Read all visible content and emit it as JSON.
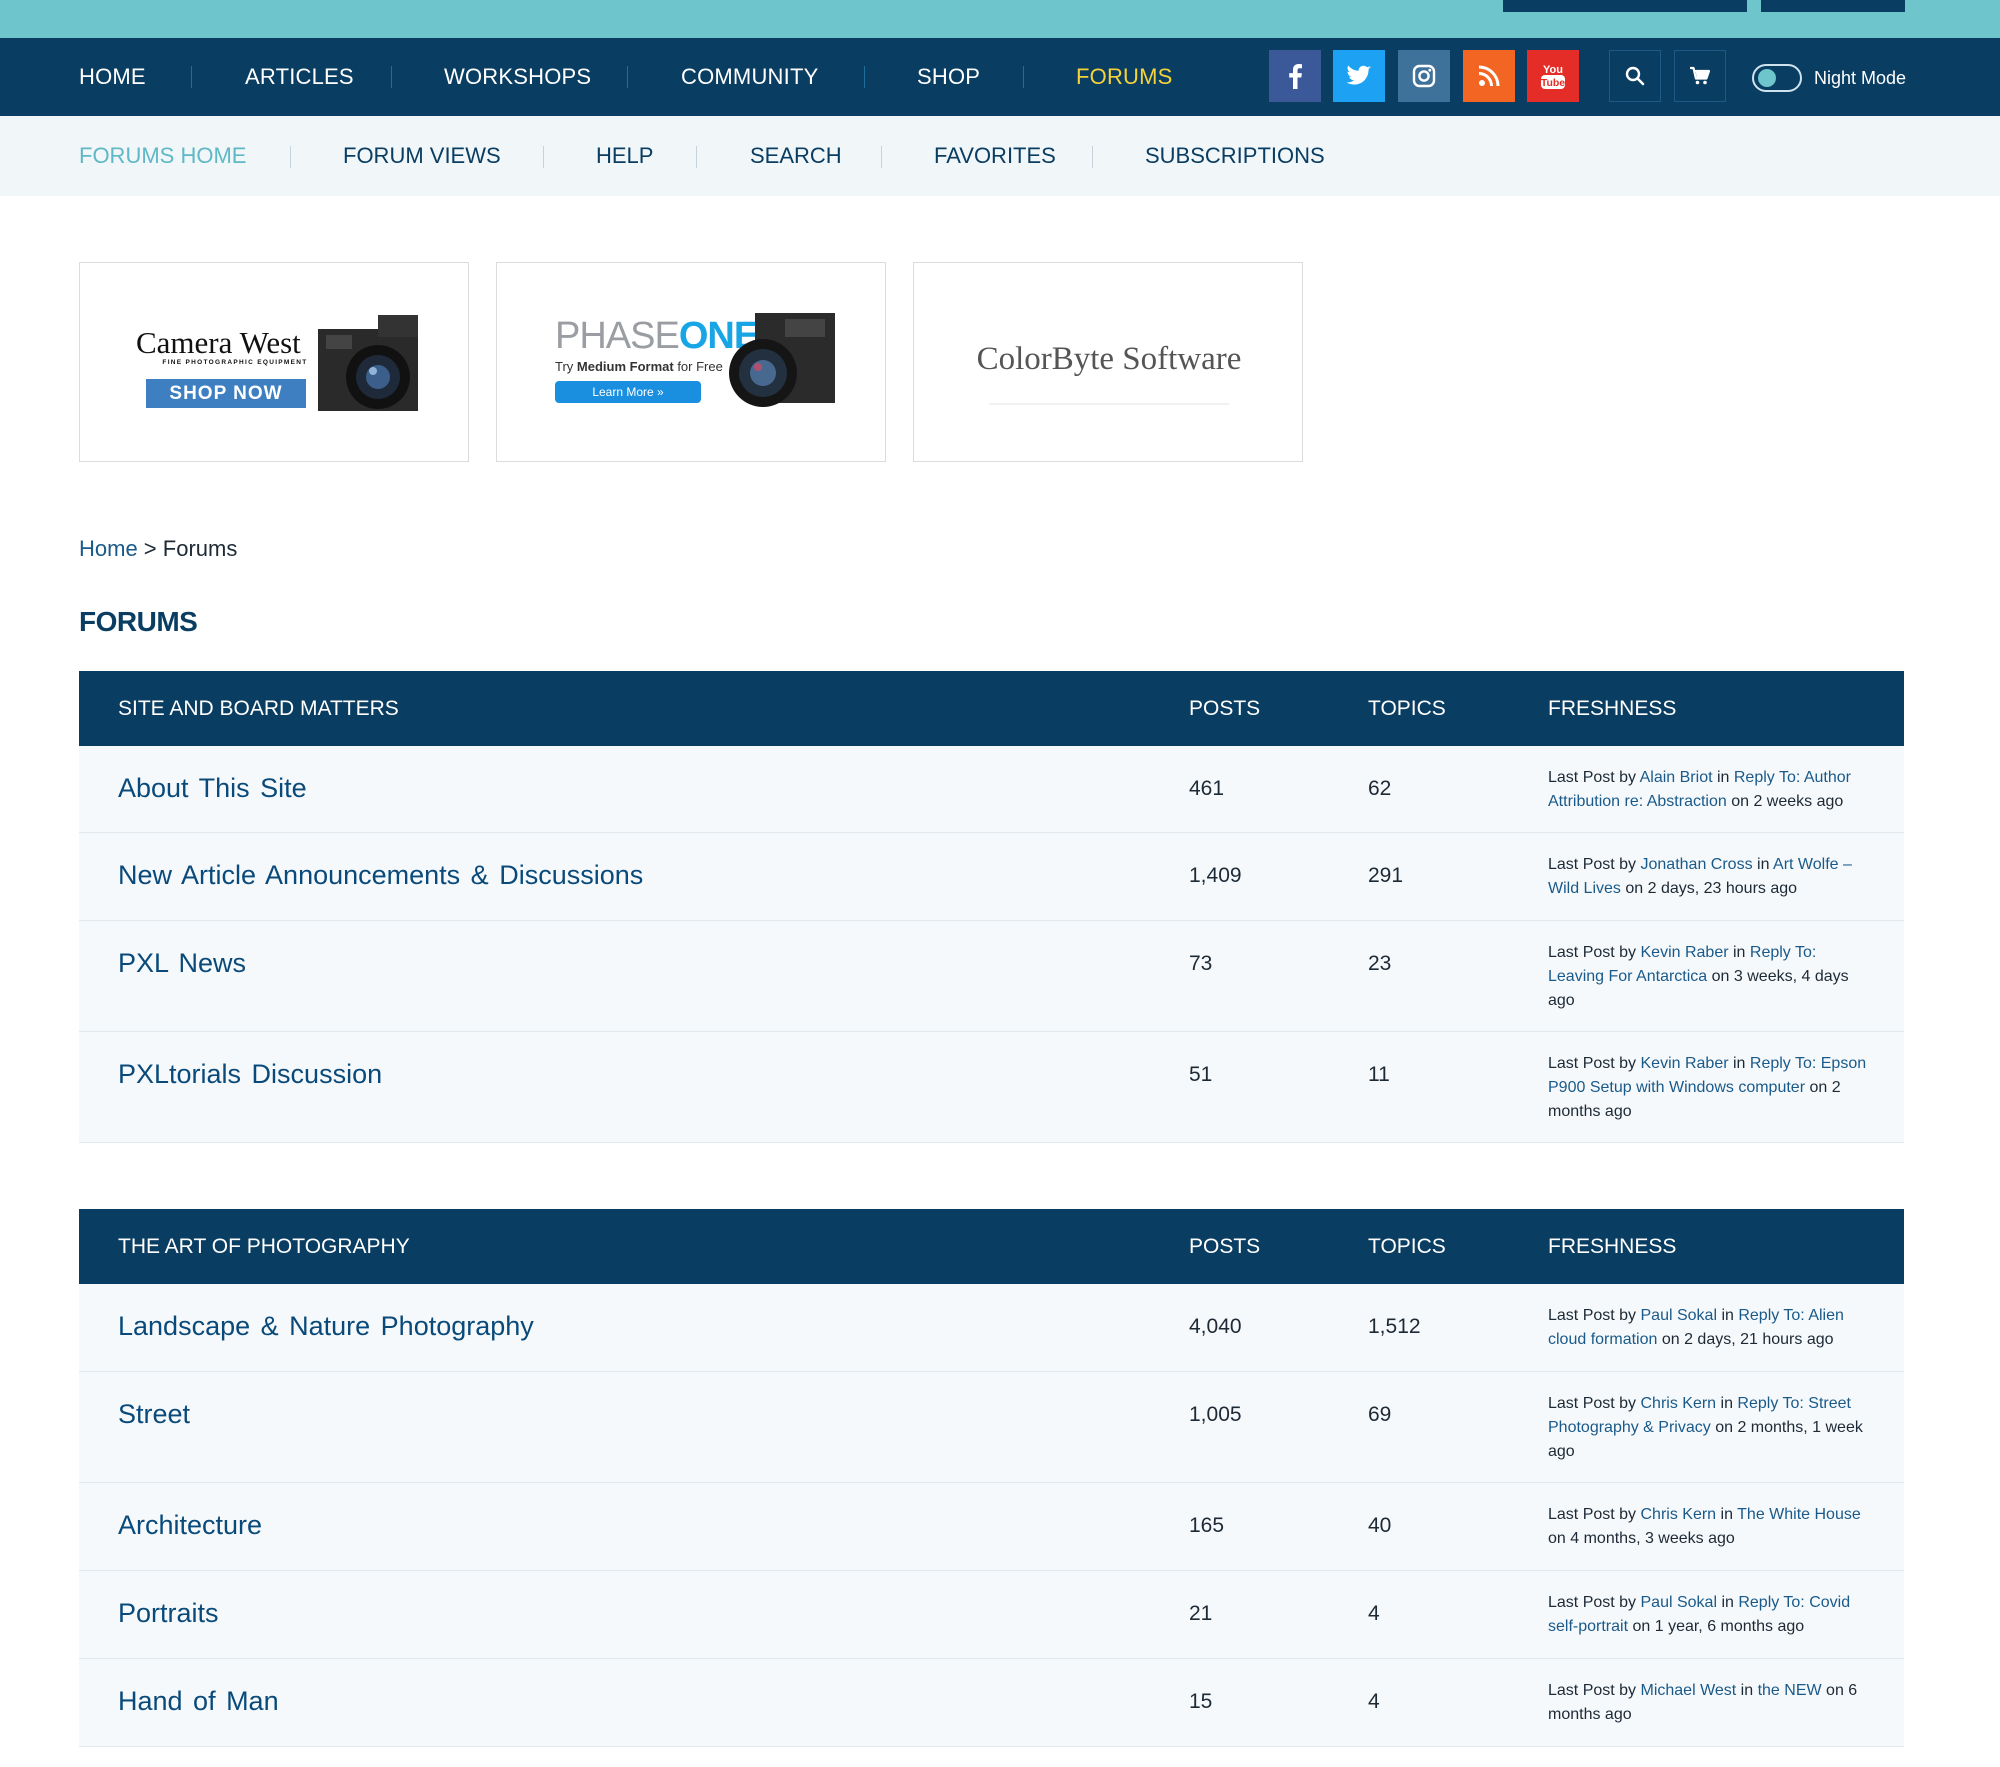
{
  "main_nav": {
    "items": [
      "HOME",
      "ARTICLES",
      "WORKSHOPS",
      "COMMUNITY",
      "SHOP",
      "FORUMS"
    ],
    "active": "FORUMS"
  },
  "social_icons": [
    {
      "name": "facebook-icon",
      "color": "#3b5998"
    },
    {
      "name": "twitter-icon",
      "color": "#1da1f2"
    },
    {
      "name": "instagram-icon",
      "color": "#3f729b"
    },
    {
      "name": "rss-icon",
      "color": "#f26522"
    },
    {
      "name": "youtube-icon",
      "color": "#e52d27"
    }
  ],
  "night_mode": {
    "label": "Night Mode",
    "enabled": false
  },
  "sub_nav": {
    "items": [
      "FORUMS HOME",
      "FORUM VIEWS",
      "HELP",
      "SEARCH",
      "FAVORITES",
      "SUBSCRIPTIONS"
    ],
    "active": "FORUMS HOME"
  },
  "ads": {
    "camera_west": {
      "name": "Camera West",
      "tagline": "FINE PHOTOGRAPHIC EQUIPMENT",
      "cta": "SHOP NOW"
    },
    "phase_one": {
      "brand_light": "PHASE",
      "brand_bold": "ONE",
      "tagline_pre": "Try ",
      "tagline_bold": "Medium Format",
      "tagline_post": " for Free",
      "cta": "Learn More »"
    },
    "colorbyte": {
      "name": "ColorByte Software"
    }
  },
  "breadcrumb": {
    "home": "Home",
    "separator": " > ",
    "current": "Forums"
  },
  "page_title": "FORUMS",
  "columns": {
    "posts": "POSTS",
    "topics": "TOPICS",
    "freshness": "FRESHNESS"
  },
  "freshness_labels": {
    "last_post_by": "Last Post by ",
    "in": " in ",
    "on": " on "
  },
  "sections": [
    {
      "title": "SITE AND BOARD MATTERS",
      "forums": [
        {
          "name": "About This Site",
          "posts": "461",
          "topics": "62",
          "author": "Alain Briot",
          "topic": "Reply To: Author Attribution re: Abstraction",
          "when": "2 weeks ago"
        },
        {
          "name": "New Article Announcements & Discussions",
          "posts": "1,409",
          "topics": "291",
          "author": "Jonathan Cross",
          "topic": "Art Wolfe – Wild Lives",
          "when": "2 days, 23 hours ago"
        },
        {
          "name": "PXL News",
          "posts": "73",
          "topics": "23",
          "author": "Kevin Raber",
          "topic": "Reply To: Leaving For Antarctica",
          "when": "3 weeks, 4 days ago"
        },
        {
          "name": "PXLtorials Discussion",
          "posts": "51",
          "topics": "11",
          "author": "Kevin Raber",
          "topic": "Reply To: Epson P900 Setup with Windows computer",
          "when": "2 months ago"
        }
      ]
    },
    {
      "title": "THE ART OF PHOTOGRAPHY",
      "forums": [
        {
          "name": "Landscape & Nature Photography",
          "posts": "4,040",
          "topics": "1,512",
          "author": "Paul Sokal",
          "topic": "Reply To: Alien cloud formation",
          "when": "2 days, 21 hours ago"
        },
        {
          "name": "Street",
          "posts": "1,005",
          "topics": "69",
          "author": "Chris Kern",
          "topic": "Reply To: Street Photography & Privacy",
          "when": "2 months, 1 week ago"
        },
        {
          "name": "Architecture",
          "posts": "165",
          "topics": "40",
          "author": "Chris Kern",
          "topic": "The White House",
          "when": "4 months, 3 weeks ago"
        },
        {
          "name": "Portraits",
          "posts": "21",
          "topics": "4",
          "author": "Paul Sokal",
          "topic": "Reply To: Covid self-portrait",
          "when": "1 year, 6 months ago"
        },
        {
          "name": "Hand of Man",
          "posts": "15",
          "topics": "4",
          "author": "Michael West",
          "topic": "the NEW",
          "when": "6 months ago"
        }
      ]
    }
  ]
}
